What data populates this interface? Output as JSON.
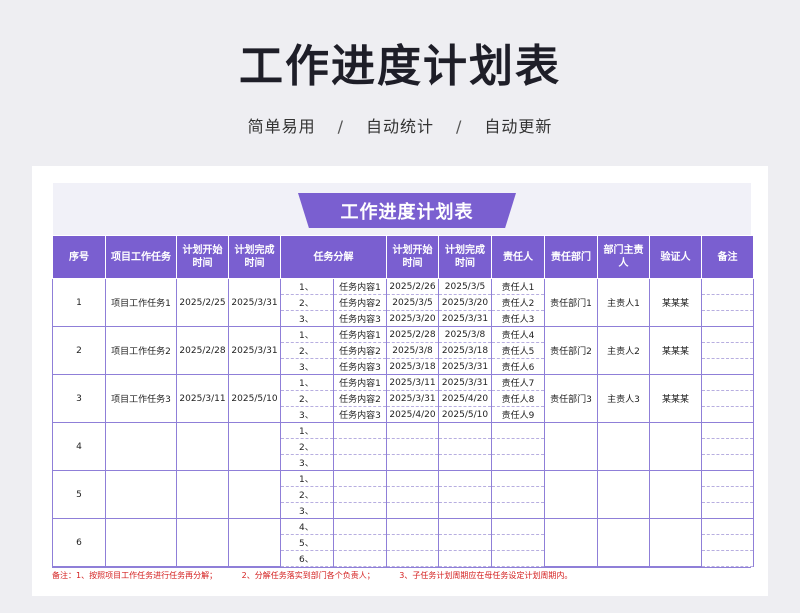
{
  "page": {
    "title": "工作进度计划表",
    "subtitle": [
      "简单易用",
      "自动统计",
      "自动更新"
    ],
    "subtitle_sep": "/"
  },
  "sheet": {
    "banner": "工作进度计划表",
    "headers": [
      "序号",
      "项目工作任务",
      "计划开始时间",
      "计划完成时间",
      "任务分解",
      "计划开始时间",
      "计划完成时间",
      "责任人",
      "责任部门",
      "部门主责人",
      "验证人",
      "备注"
    ],
    "groups": [
      {
        "no": "1",
        "task": "项目工作任务1",
        "start": "2025/2/25",
        "end": "2025/3/31",
        "dept": "责任部门1",
        "lead": "主责人1",
        "verifier": "某某某",
        "rows": [
          {
            "idx": "1、",
            "sub": "任务内容1",
            "s": "2025/2/26",
            "e": "2025/3/5",
            "owner": "责任人1"
          },
          {
            "idx": "2、",
            "sub": "任务内容2",
            "s": "2025/3/5",
            "e": "2025/3/20",
            "owner": "责任人2"
          },
          {
            "idx": "3、",
            "sub": "任务内容3",
            "s": "2025/3/20",
            "e": "2025/3/31",
            "owner": "责任人3"
          }
        ]
      },
      {
        "no": "2",
        "task": "项目工作任务2",
        "start": "2025/2/28",
        "end": "2025/3/31",
        "dept": "责任部门2",
        "lead": "主责人2",
        "verifier": "某某某",
        "rows": [
          {
            "idx": "1、",
            "sub": "任务内容1",
            "s": "2025/2/28",
            "e": "2025/3/8",
            "owner": "责任人4"
          },
          {
            "idx": "2、",
            "sub": "任务内容2",
            "s": "2025/3/8",
            "e": "2025/3/18",
            "owner": "责任人5"
          },
          {
            "idx": "3、",
            "sub": "任务内容3",
            "s": "2025/3/18",
            "e": "2025/3/31",
            "owner": "责任人6"
          }
        ]
      },
      {
        "no": "3",
        "task": "项目工作任务3",
        "start": "2025/3/11",
        "end": "2025/5/10",
        "dept": "责任部门3",
        "lead": "主责人3",
        "verifier": "某某某",
        "rows": [
          {
            "idx": "1、",
            "sub": "任务内容1",
            "s": "2025/3/11",
            "e": "2025/3/31",
            "owner": "责任人7"
          },
          {
            "idx": "2、",
            "sub": "任务内容2",
            "s": "2025/3/31",
            "e": "2025/4/20",
            "owner": "责任人8"
          },
          {
            "idx": "3、",
            "sub": "任务内容3",
            "s": "2025/4/20",
            "e": "2025/5/10",
            "owner": "责任人9"
          }
        ]
      },
      {
        "no": "4",
        "task": "",
        "start": "",
        "end": "",
        "dept": "",
        "lead": "",
        "verifier": "",
        "rows": [
          {
            "idx": "1、",
            "sub": "",
            "s": "",
            "e": "",
            "owner": ""
          },
          {
            "idx": "2、",
            "sub": "",
            "s": "",
            "e": "",
            "owner": ""
          },
          {
            "idx": "3、",
            "sub": "",
            "s": "",
            "e": "",
            "owner": ""
          }
        ]
      },
      {
        "no": "5",
        "task": "",
        "start": "",
        "end": "",
        "dept": "",
        "lead": "",
        "verifier": "",
        "rows": [
          {
            "idx": "1、",
            "sub": "",
            "s": "",
            "e": "",
            "owner": ""
          },
          {
            "idx": "2、",
            "sub": "",
            "s": "",
            "e": "",
            "owner": ""
          },
          {
            "idx": "3、",
            "sub": "",
            "s": "",
            "e": "",
            "owner": ""
          }
        ]
      },
      {
        "no": "6",
        "task": "",
        "start": "",
        "end": "",
        "dept": "",
        "lead": "",
        "verifier": "",
        "rows": [
          {
            "idx": "4、",
            "sub": "",
            "s": "",
            "e": "",
            "owner": ""
          },
          {
            "idx": "5、",
            "sub": "",
            "s": "",
            "e": "",
            "owner": ""
          },
          {
            "idx": "6、",
            "sub": "",
            "s": "",
            "e": "",
            "owner": ""
          }
        ]
      }
    ],
    "notes": [
      "备注：1、按照项目工作任务进行任务再分解；",
      "2、分解任务落实到部门各个负责人；",
      "3、子任务计划周期应在母任务设定计划周期内。"
    ]
  },
  "colors": {
    "accent": "#7a5fd0",
    "note": "#d42020",
    "background": "#eeeef2"
  }
}
